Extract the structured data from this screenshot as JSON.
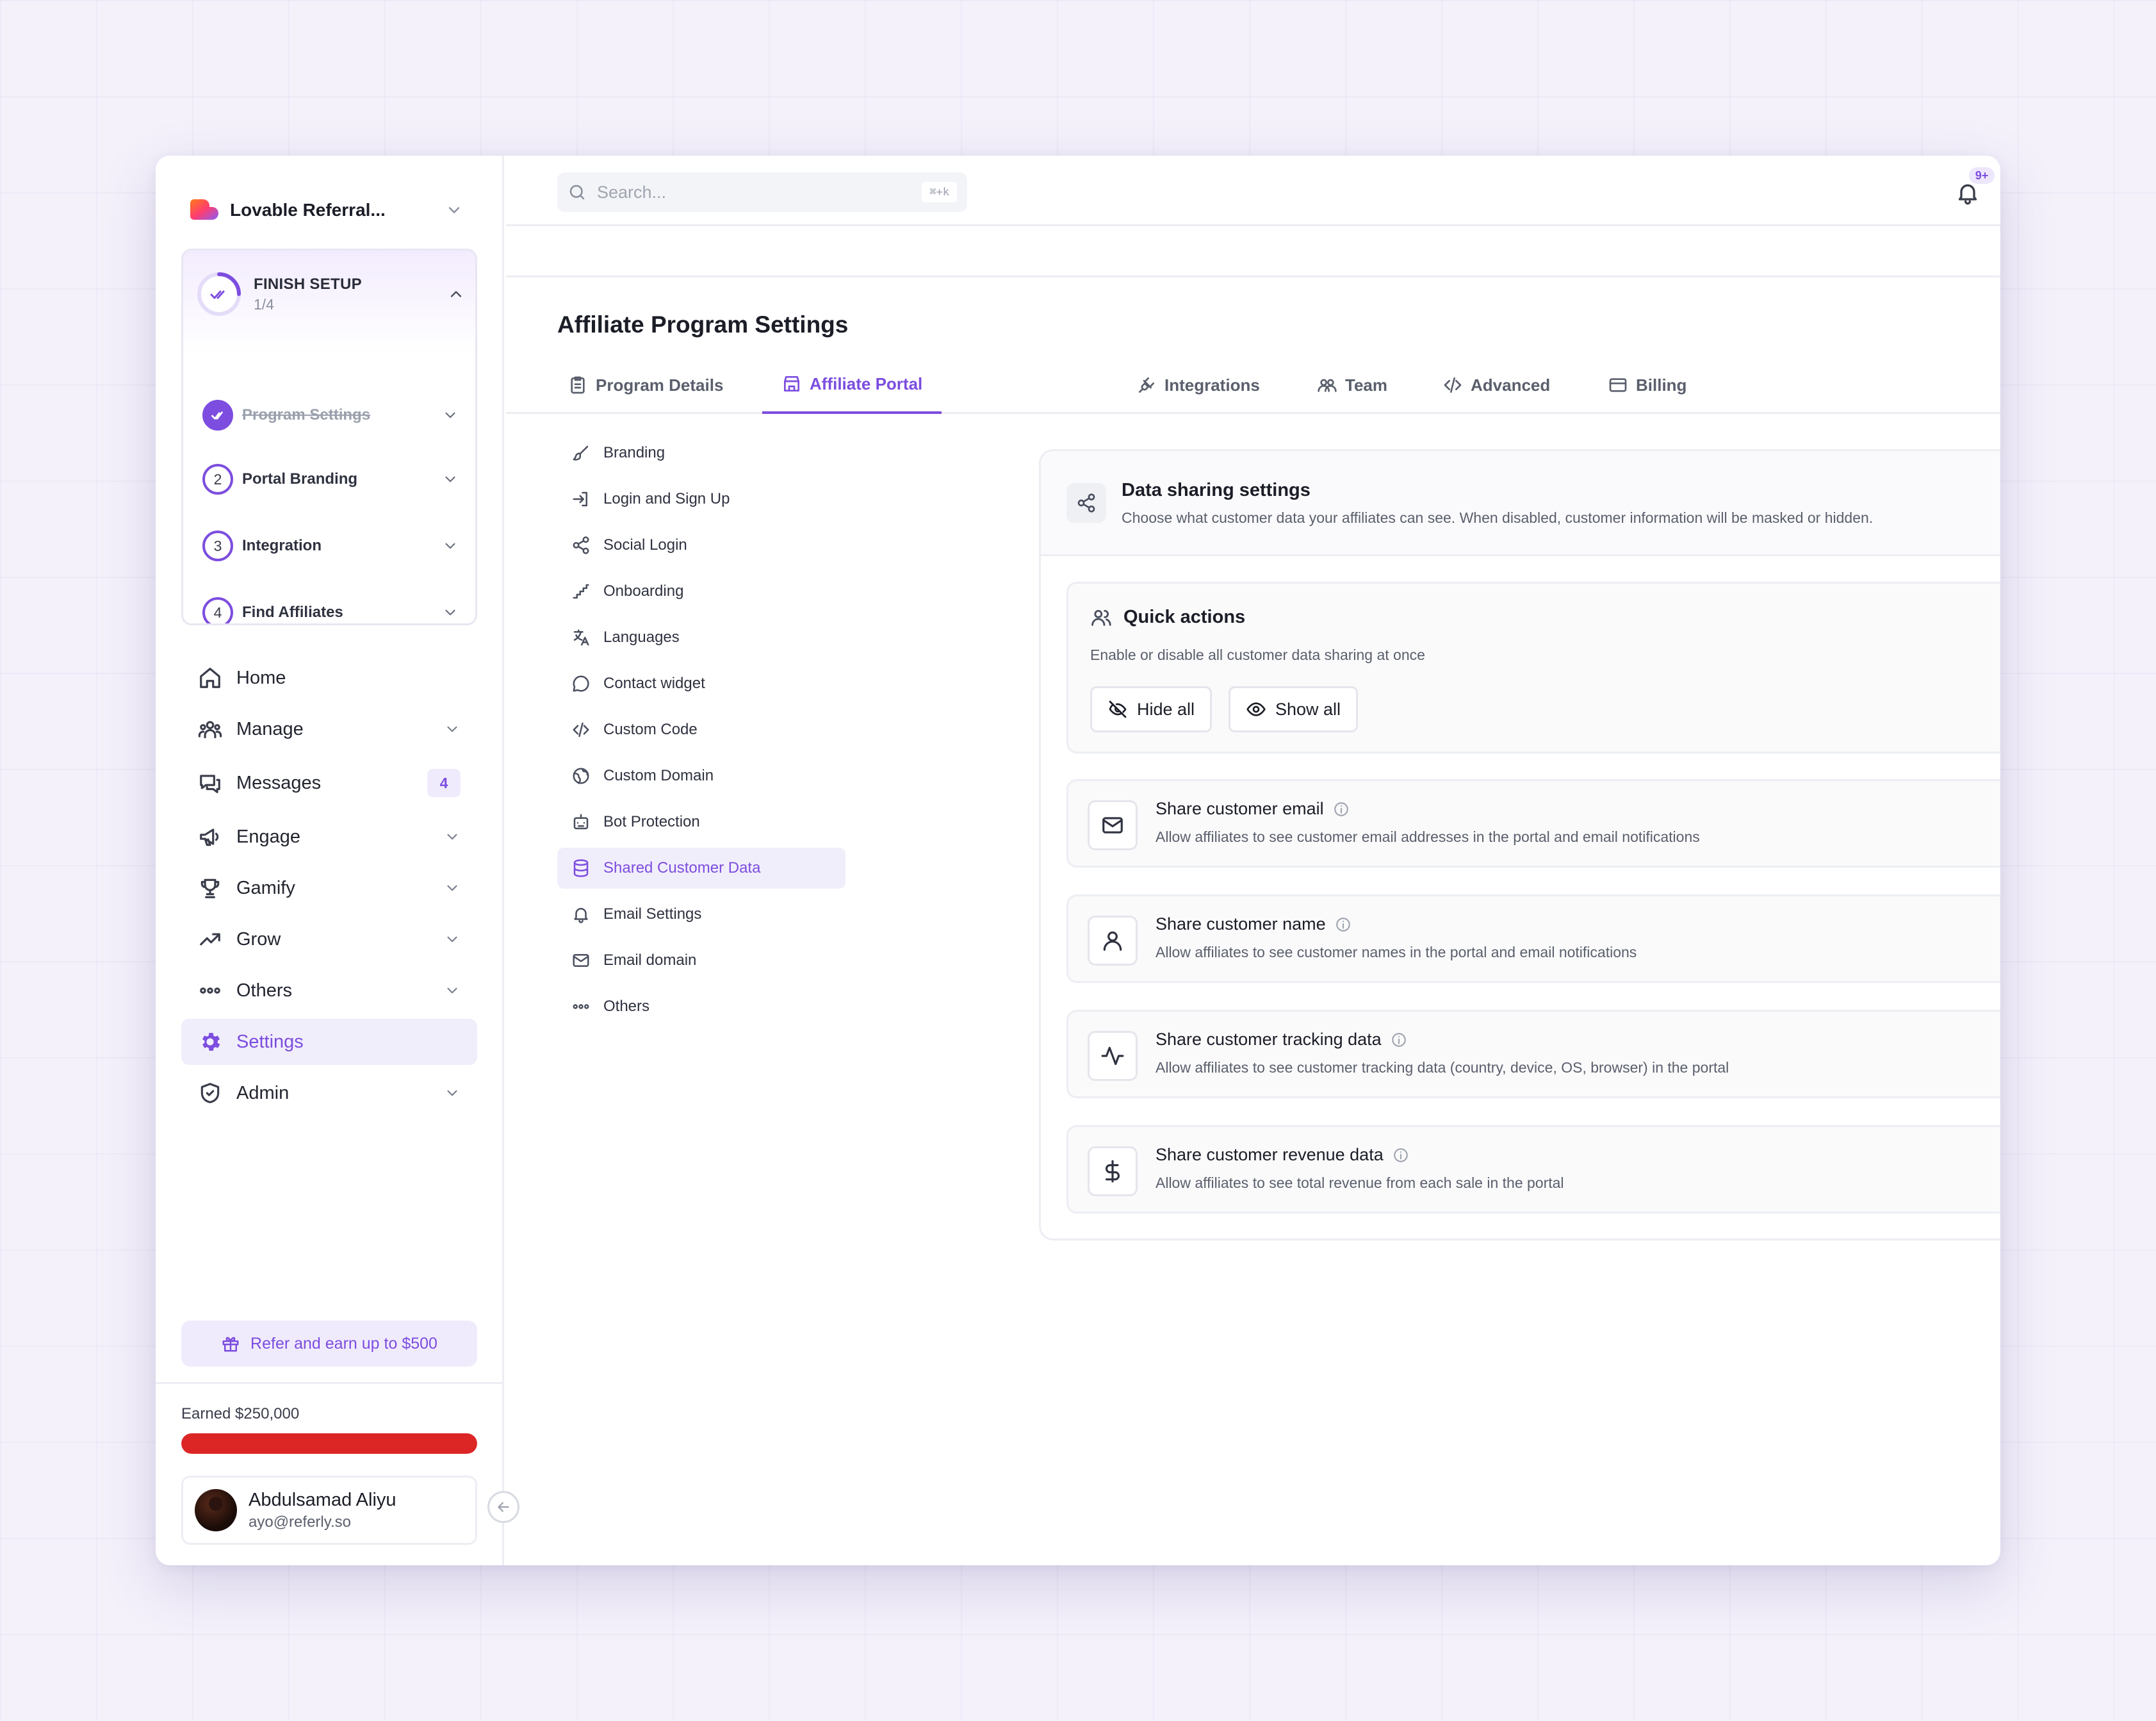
{
  "app": {
    "workspace_name": "Lovable Referral..."
  },
  "setup": {
    "title": "FINISH SETUP",
    "progress_text": "1/4",
    "progress_fraction": 0.25,
    "steps": [
      {
        "number": "1",
        "label": "Program Settings",
        "completed": true
      },
      {
        "number": "2",
        "label": "Portal Branding",
        "completed": false
      },
      {
        "number": "3",
        "label": "Integration",
        "completed": false
      },
      {
        "number": "4",
        "label": "Find Affiliates",
        "completed": false
      }
    ]
  },
  "sidebar": {
    "items": [
      {
        "label": "Home",
        "icon": "home-icon"
      },
      {
        "label": "Manage",
        "icon": "users-icon"
      },
      {
        "label": "Messages",
        "icon": "messages-icon",
        "badge": "4"
      },
      {
        "label": "Engage",
        "icon": "megaphone-icon"
      },
      {
        "label": "Gamify",
        "icon": "trophy-icon"
      },
      {
        "label": "Grow",
        "icon": "trending-up-icon"
      },
      {
        "label": "Others",
        "icon": "more-icon"
      },
      {
        "label": "Settings",
        "icon": "gear-icon",
        "active": true
      },
      {
        "label": "Admin",
        "icon": "shield-icon"
      }
    ],
    "refer_label": "Refer and earn up to $500",
    "earned_label": "Earned $250,000",
    "earned_progress": 1.0,
    "earned_bar_color": "#dc2626"
  },
  "user": {
    "name": "Abdulsamad Aliyu",
    "email": "ayo@referly.so"
  },
  "topbar": {
    "search_placeholder": "Search...",
    "search_shortcut": "⌘+k",
    "notification_count": "9+"
  },
  "page": {
    "title": "Affiliate Program Settings",
    "tabs": [
      {
        "label": "Program Details",
        "icon": "clipboard-icon"
      },
      {
        "label": "Affiliate Portal",
        "icon": "store-icon",
        "active": true
      },
      {
        "label": "Integrations",
        "icon": "plug-icon"
      },
      {
        "label": "Team",
        "icon": "team-icon"
      },
      {
        "label": "Advanced",
        "icon": "code-icon"
      },
      {
        "label": "Billing",
        "icon": "card-icon"
      }
    ]
  },
  "subnav": {
    "items": [
      {
        "label": "Branding",
        "icon": "brush-icon"
      },
      {
        "label": "Login and Sign Up",
        "icon": "login-icon"
      },
      {
        "label": "Social Login",
        "icon": "share-icon"
      },
      {
        "label": "Onboarding",
        "icon": "steps-icon"
      },
      {
        "label": "Languages",
        "icon": "translate-icon"
      },
      {
        "label": "Contact widget",
        "icon": "chat-icon"
      },
      {
        "label": "Custom Code",
        "icon": "code-icon"
      },
      {
        "label": "Custom Domain",
        "icon": "globe-icon"
      },
      {
        "label": "Bot Protection",
        "icon": "bot-icon"
      },
      {
        "label": "Shared Customer Data",
        "icon": "database-icon",
        "active": true
      },
      {
        "label": "Email Settings",
        "icon": "bell-icon"
      },
      {
        "label": "Email domain",
        "icon": "mail-icon"
      },
      {
        "label": "Others",
        "icon": "more-icon"
      }
    ]
  },
  "data_sharing": {
    "title": "Data sharing settings",
    "description": "Choose what customer data your affiliates can see. When disabled, customer information will be masked or hidden.",
    "quick_actions": {
      "title": "Quick actions",
      "description": "Enable or disable all customer data sharing at once",
      "hide_all_label": "Hide all",
      "show_all_label": "Show all"
    },
    "settings": [
      {
        "title": "Share customer email",
        "description": "Allow affiliates to see customer email addresses in the portal and email notifications",
        "enabled": true,
        "icon": "mail-icon"
      },
      {
        "title": "Share customer name",
        "description": "Allow affiliates to see customer names in the portal and email notifications",
        "enabled": true,
        "icon": "user-icon"
      },
      {
        "title": "Share customer tracking data",
        "description": "Allow affiliates to see customer tracking data (country, device, OS, browser) in the portal",
        "enabled": false,
        "icon": "activity-icon"
      },
      {
        "title": "Share customer revenue data",
        "description": "Allow affiliates to see total revenue from each sale in the portal",
        "enabled": false,
        "icon": "dollar-icon"
      }
    ]
  },
  "colors": {
    "accent": "#7c4ddf",
    "accent_light": "#f1eefb",
    "progress_red": "#dc2626"
  }
}
